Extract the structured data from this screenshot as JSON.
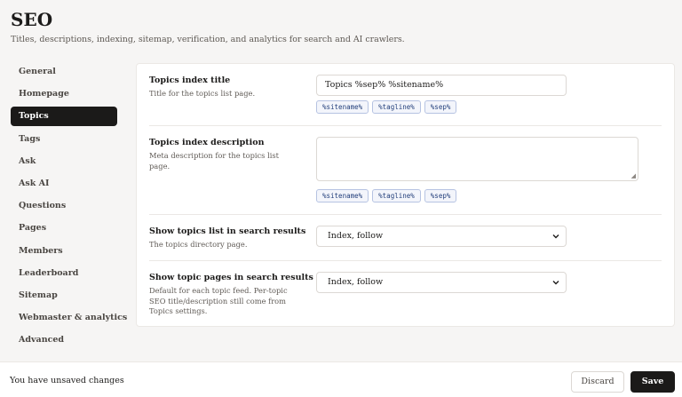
{
  "header": {
    "title": "SEO",
    "subtitle": "Titles, descriptions, indexing, sitemap, verification, and analytics for search and AI crawlers."
  },
  "sidebar": {
    "items": [
      {
        "label": "General"
      },
      {
        "label": "Homepage"
      },
      {
        "label": "Topics"
      },
      {
        "label": "Tags"
      },
      {
        "label": "Ask"
      },
      {
        "label": "Ask AI"
      },
      {
        "label": "Questions"
      },
      {
        "label": "Pages"
      },
      {
        "label": "Members"
      },
      {
        "label": "Leaderboard"
      },
      {
        "label": "Sitemap"
      },
      {
        "label": "Webmaster & analytics"
      },
      {
        "label": "Advanced"
      }
    ],
    "active": "Topics"
  },
  "settings": {
    "index_title": {
      "label": "Topics index title",
      "description": "Title for the topics list page.",
      "value": "Topics %sep% %sitename%",
      "tags": [
        "%sitename%",
        "%tagline%",
        "%sep%"
      ]
    },
    "index_description": {
      "label": "Topics index description",
      "description": "Meta description for the topics list page.",
      "value": "",
      "tags": [
        "%sitename%",
        "%tagline%",
        "%sep%"
      ]
    },
    "list_search": {
      "label": "Show topics list in search results",
      "description": "The topics directory page.",
      "selected": "Index, follow"
    },
    "pages_search": {
      "label": "Show topic pages in search results",
      "description": "Default for each topic feed. Per-topic SEO title/description still come from Topics settings.",
      "selected": "Index, follow"
    }
  },
  "footer": {
    "message": "You have unsaved changes",
    "discard_label": "Discard",
    "save_label": "Save"
  }
}
